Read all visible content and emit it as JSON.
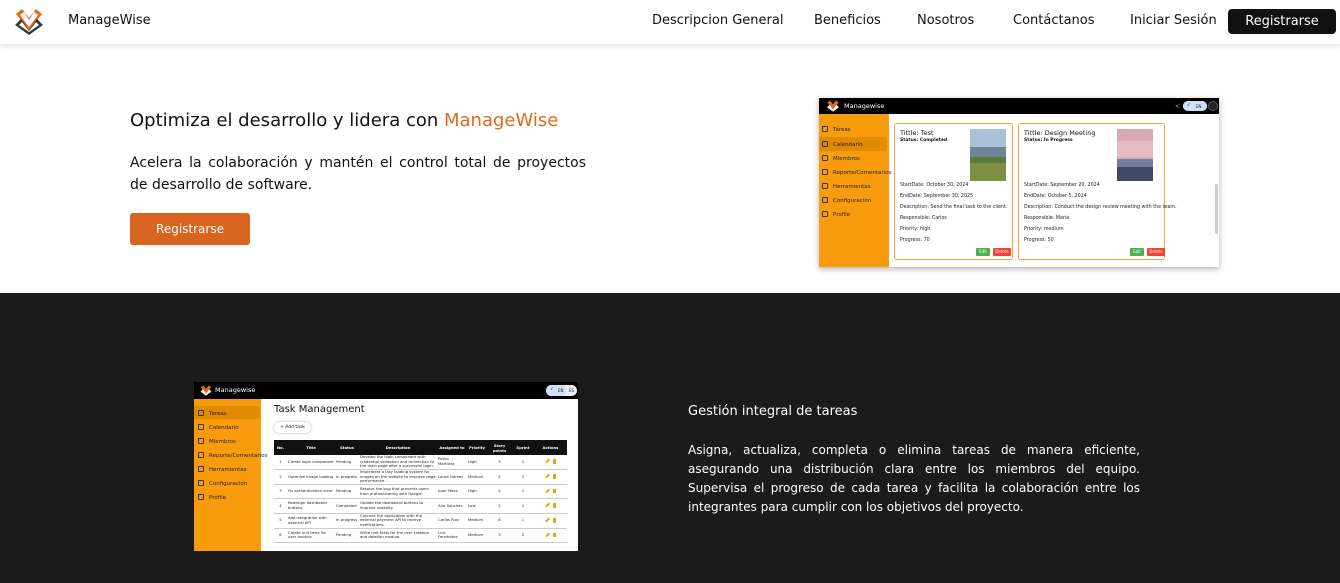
{
  "nav": {
    "brand": "ManageWise",
    "links": [
      "Descripcion General",
      "Beneficios",
      "Nosotros",
      "Contáctanos",
      "Iniciar Sesión"
    ],
    "register": "Registrarse"
  },
  "hero": {
    "title_prefix": "Optimiza el desarrollo y lidera con ",
    "title_accent": "ManageWise",
    "description": "Acelera la colaboración y mantén el control total de proyectos de desarrollo de software.",
    "button": "Registrarse"
  },
  "mock1": {
    "brand": "Managewise",
    "lang_on": "EN",
    "sidebar": [
      "Tareas",
      "Calendario",
      "Miembros",
      "Reporte/Comentarios",
      "Herramientas",
      "Configuracion",
      "Profile"
    ],
    "cards": [
      {
        "title": "Tittle: Test",
        "status": "Status: Completed",
        "lines": [
          "StartDate: October 30, 2024",
          "EndDate: September 30, 2025",
          "Description: Send the final task to the client.",
          "Responsible: Carlos",
          "Priority: high",
          "Progress: 70"
        ],
        "edit": "Edit",
        "delete": "Delete"
      },
      {
        "title": "Tittle: Design Meeting",
        "status": "Status: In Progress",
        "lines": [
          "StartDate: September 20, 2024",
          "EndDate: October 5, 2024",
          "Description: Conduct the design review meeting with the team.",
          "Responsible: Maria",
          "Priority: medium",
          "Progress: 50"
        ],
        "edit": "Edit",
        "delete": "Delete"
      }
    ]
  },
  "mock2": {
    "brand": "Managewise",
    "lang_on": "EN",
    "lang_off": "ES",
    "sidebar": [
      "Tareas",
      "Calendario",
      "Miembros",
      "Reporte/Comentarios",
      "Herramientas",
      "Configuracion",
      "Profile"
    ],
    "title": "Task Management",
    "add_task": "+ Add task",
    "headers": [
      "No.",
      "Title",
      "Status",
      "Description",
      "Assigned to",
      "Priority",
      "Story points",
      "Sprint",
      "Actions"
    ],
    "rows": [
      [
        "1",
        "Create login component",
        "Pending",
        "Develop the login component with credential validation and redirection to the main page after a successful login.",
        "Pedro Martinez",
        "High",
        "3",
        "2"
      ],
      [
        "2",
        "Optimize image loading",
        "In progress",
        "Implement a lazy loading system for images on the website to improve page performance.",
        "Laura Gómez",
        "Medium",
        "5",
        "3"
      ],
      [
        "3",
        "Fix authentication error",
        "Pending",
        "Resolve the bug that prevents users from authenticating with Google.",
        "Juan Pérez",
        "High",
        "2",
        "2"
      ],
      [
        "4",
        "Redesign dashboard buttons",
        "Completed",
        "Update the dashboard buttons to improve usability.",
        "Ana Sánchez",
        "Low",
        "2",
        "1"
      ],
      [
        "5",
        "Add integration with external API",
        "In progress",
        "Connect the application with the external payment API to receive notifications.",
        "Carlos Ruiz",
        "Medium",
        "8",
        "1"
      ],
      [
        "6",
        "Create unit tests for user module",
        "Pending",
        "Write unit tests for the user creation and deletion module.",
        "Luis Fernández",
        "Medium",
        "3",
        "2"
      ]
    ]
  },
  "feature": {
    "title": "Gestión integral de tareas",
    "description": "Asigna, actualiza, completa o elimina tareas de manera eficiente, asegurando una distribución clara entre los miembros del equipo. Supervisa el progreso de cada tarea y facilita la colaboración entre los integrantes para cumplir con los objetivos del proyecto."
  },
  "colors": {
    "accent": "#e06b1a",
    "button": "#d96420",
    "sidebar": "#f89c0e",
    "dark_bg": "#1b1b1b"
  }
}
